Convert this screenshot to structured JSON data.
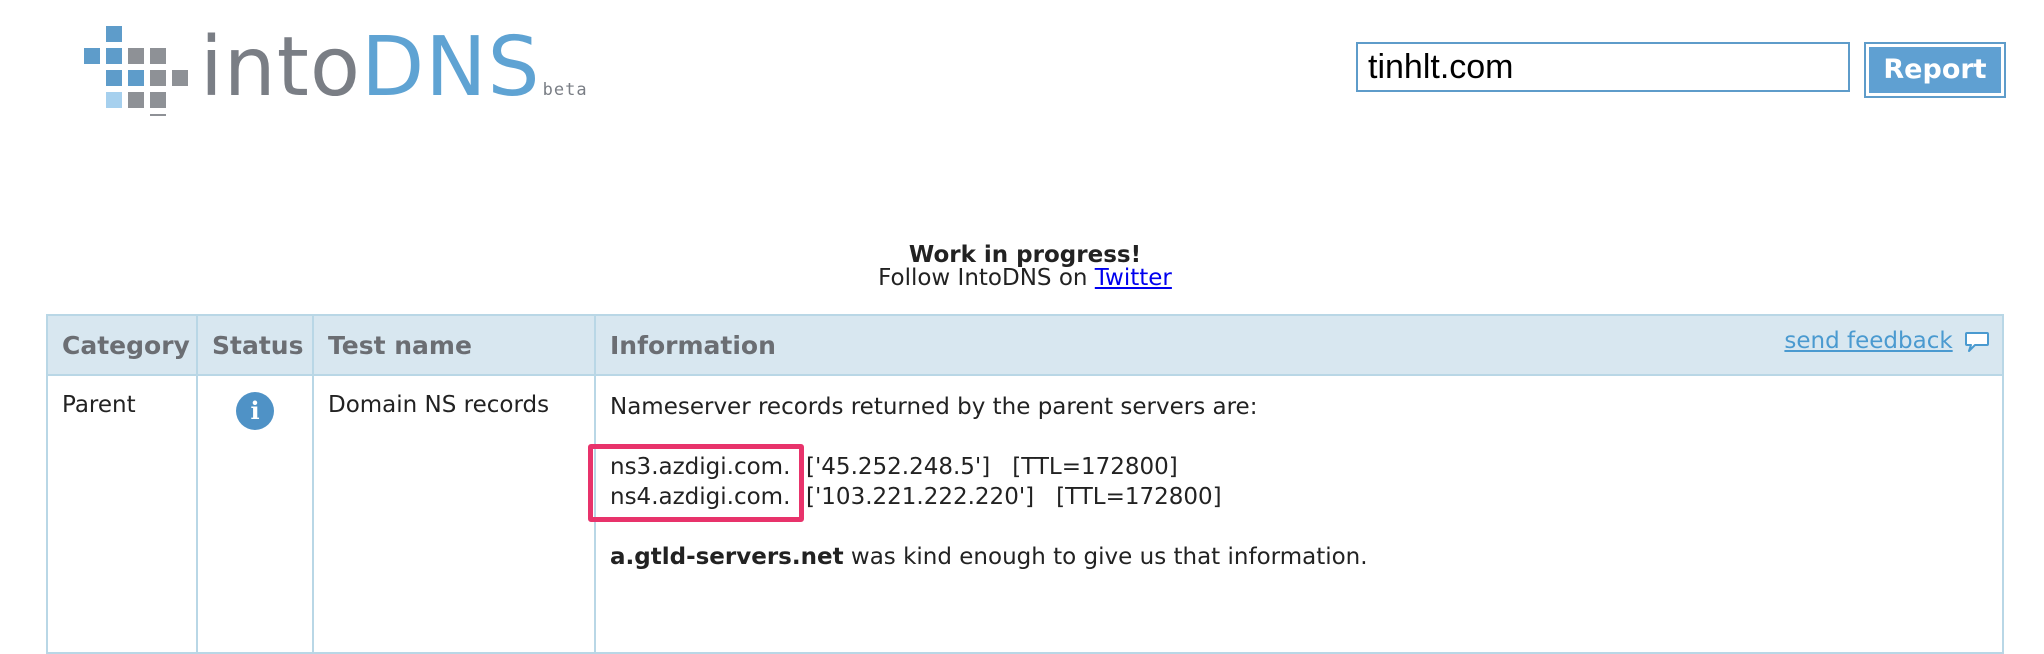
{
  "header": {
    "logo": {
      "into": "into",
      "dns": "DNS",
      "beta": "beta"
    },
    "search": {
      "value": "tinhlt.com",
      "button_label": "Report"
    }
  },
  "notice": {
    "title": "Work in progress!",
    "follow_prefix": "Follow IntoDNS on ",
    "follow_link": "Twitter"
  },
  "table": {
    "headers": [
      "Category",
      "Status",
      "Test name",
      "Information"
    ],
    "feedback_label": "send feedback",
    "rows": [
      {
        "category": "Parent",
        "status_icon": "info-icon",
        "test_name": "Domain NS records",
        "intro": "Nameserver records returned by the parent servers are:",
        "nameservers": [
          {
            "name": "ns3.azdigi.com.",
            "ip": "['45.252.248.5']",
            "ttl": "[TTL=172800]"
          },
          {
            "name": "ns4.azdigi.com.",
            "ip": "['103.221.222.220']",
            "ttl": "[TTL=172800]"
          }
        ],
        "source_server": "a.gtld-servers.net",
        "source_suffix": " was kind enough to give us that information."
      }
    ]
  },
  "colors": {
    "accent": "#5fa3d3",
    "header_bg": "#d8e7f0",
    "highlight": "#e8336b"
  }
}
